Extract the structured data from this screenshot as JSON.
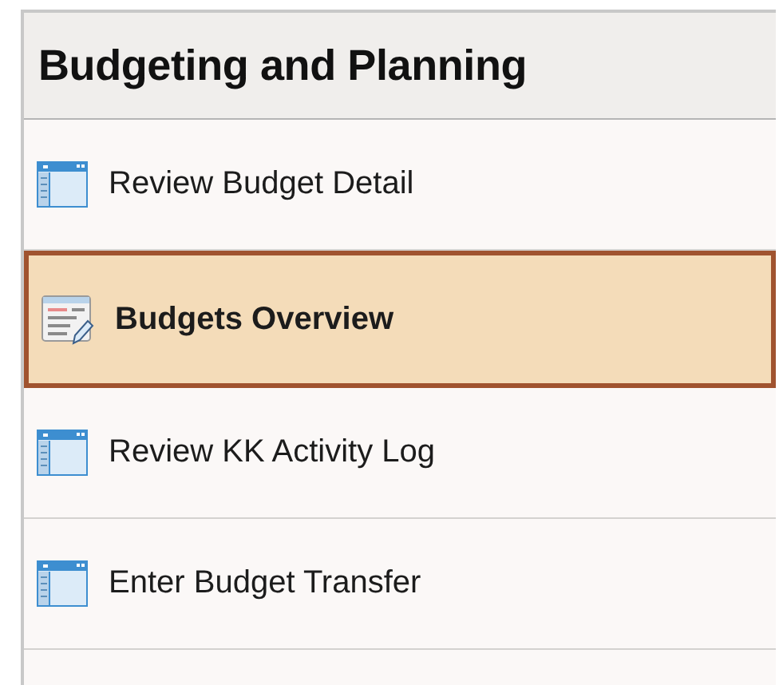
{
  "panel": {
    "title": "Budgeting and Planning"
  },
  "items": [
    {
      "label": "Review Budget Detail",
      "kind": "page",
      "selected": false
    },
    {
      "label": "Budgets Overview",
      "kind": "overview",
      "selected": true
    },
    {
      "label": "Review KK Activity Log",
      "kind": "page",
      "selected": false
    },
    {
      "label": "Enter Budget Transfer",
      "kind": "page",
      "selected": false
    }
  ]
}
